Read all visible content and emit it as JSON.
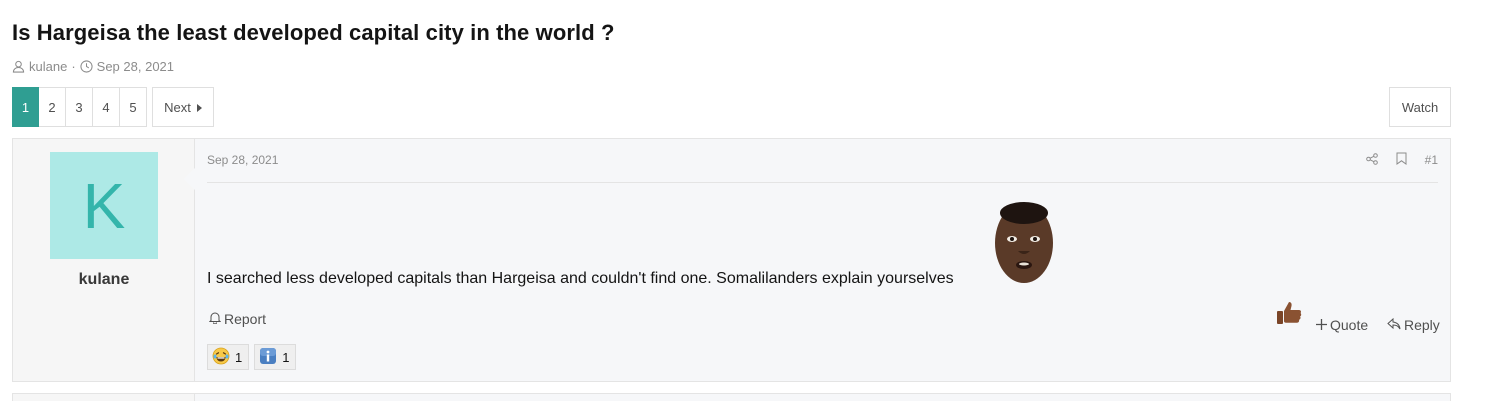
{
  "thread": {
    "title": "Is Hargeisa the least developed capital city in the world ?",
    "author": "kulane",
    "separator": "·",
    "date": "Sep 28, 2021"
  },
  "pagination": {
    "pages": [
      "1",
      "2",
      "3",
      "4",
      "5"
    ],
    "current": "1",
    "next_label": "Next"
  },
  "watch_label": "Watch",
  "post": {
    "avatar_letter": "K",
    "username": "kulane",
    "date": "Sep 28, 2021",
    "number": "#1",
    "body": "I searched less developed capitals than Hargeisa and couldn't find one. Somalilanders explain yourselves",
    "report_label": "Report",
    "quote_label": "Quote",
    "reply_label": "Reply",
    "reactions": [
      {
        "icon": "laughing-emoji-icon",
        "count": "1"
      },
      {
        "icon": "info-emoji-icon",
        "count": "1"
      }
    ]
  },
  "colors": {
    "accent": "#2f9e92",
    "avatar_bg": "#ade9e6",
    "avatar_letter": "#34b5ab",
    "post_bg": "#f6f7f9"
  }
}
